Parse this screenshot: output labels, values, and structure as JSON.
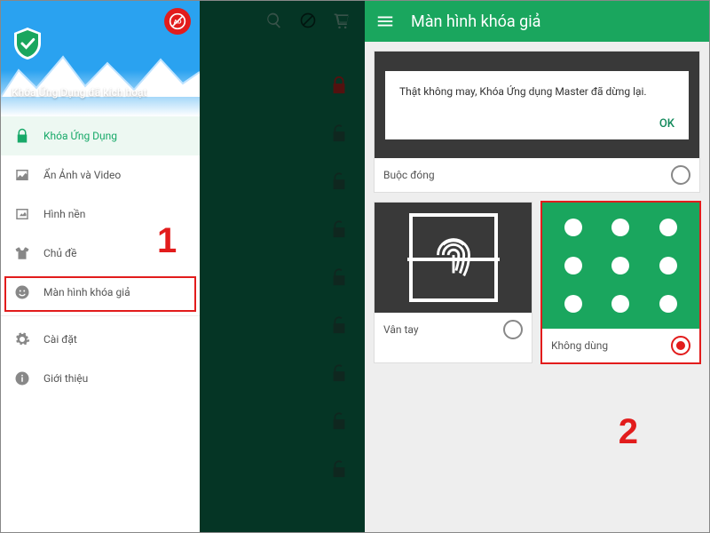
{
  "left": {
    "header_title": "Khóa Ứng Dụng đã kích hoạt",
    "menu": [
      {
        "label": "Khóa Ứng Dụng"
      },
      {
        "label": "Ẩn Ảnh và Video"
      },
      {
        "label": "Hình nền"
      },
      {
        "label": "Chủ đề"
      },
      {
        "label": "Màn hình khóa giả"
      },
      {
        "label": "Cài đặt"
      },
      {
        "label": "Giới thiệu"
      }
    ]
  },
  "right": {
    "title": "Màn hình khóa giả",
    "dialog_text": "Thật không may, Khóa Ứng dụng Master đã dừng lại.",
    "dialog_ok": "OK",
    "option1_label": "Buộc đóng",
    "option2_label": "Vân tay",
    "option3_label": "Không dùng"
  },
  "annotations": {
    "step1": "1",
    "step2": "2"
  }
}
